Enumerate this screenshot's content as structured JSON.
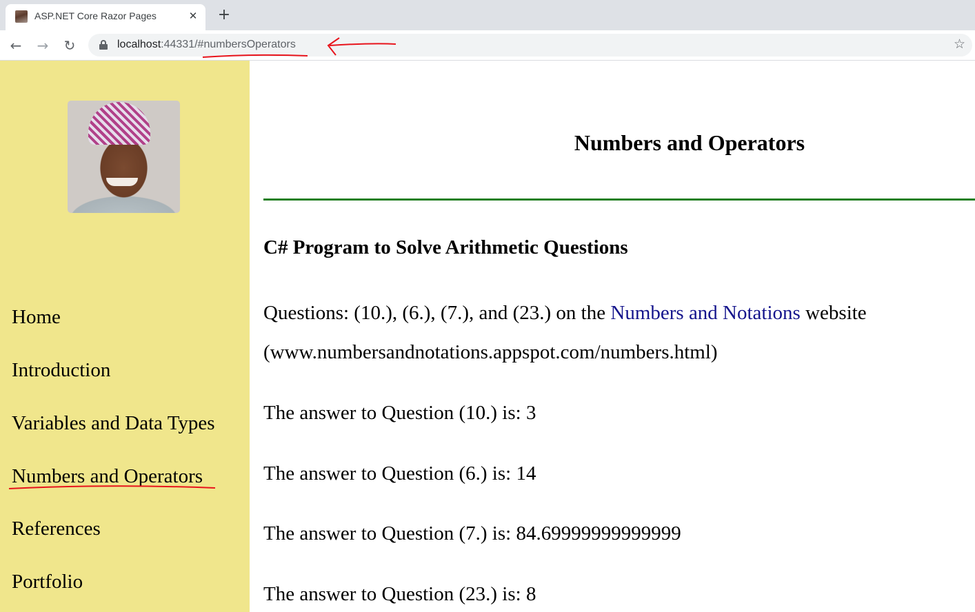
{
  "browser": {
    "tab": {
      "title": "ASP.NET Core Razor Pages",
      "favicon": "profile-photo-favicon",
      "close_glyph": "✕"
    },
    "new_tab_glyph": "+",
    "nav": {
      "back_glyph": "←",
      "forward_glyph": "→",
      "reload_glyph": "↻"
    },
    "address_bar": {
      "host": "localhost",
      "rest": ":44331/#numbersOperators",
      "bookmark_glyph": "☆"
    }
  },
  "sidebar": {
    "avatar_alt": "profile photo",
    "items": [
      {
        "label": "Home"
      },
      {
        "label": "Introduction"
      },
      {
        "label": "Variables and Data Types"
      },
      {
        "label": "Numbers and Operators"
      },
      {
        "label": "References"
      },
      {
        "label": "Portfolio"
      }
    ]
  },
  "main": {
    "title": "Numbers and Operators",
    "section_title": "C# Program to Solve Arithmetic Questions",
    "intro": {
      "prefix": "Questions: (10.), (6.), (7.), and (23.) on the ",
      "link_text": "Numbers and Notations",
      "suffix": " website",
      "url_line": "(www.numbersandnotations.appspot.com/numbers.html)"
    },
    "answers": [
      "The answer to Question (10.) is: 3",
      "The answer to Question (6.) is: 14",
      "The answer to Question (7.) is: 84.69999999999999",
      "The answer to Question (23.) is: 8"
    ]
  },
  "colors": {
    "sidebar_bg": "#f0e68c",
    "divider": "#1f7f1f",
    "link": "#14148c",
    "annotation": "#e8141c"
  }
}
